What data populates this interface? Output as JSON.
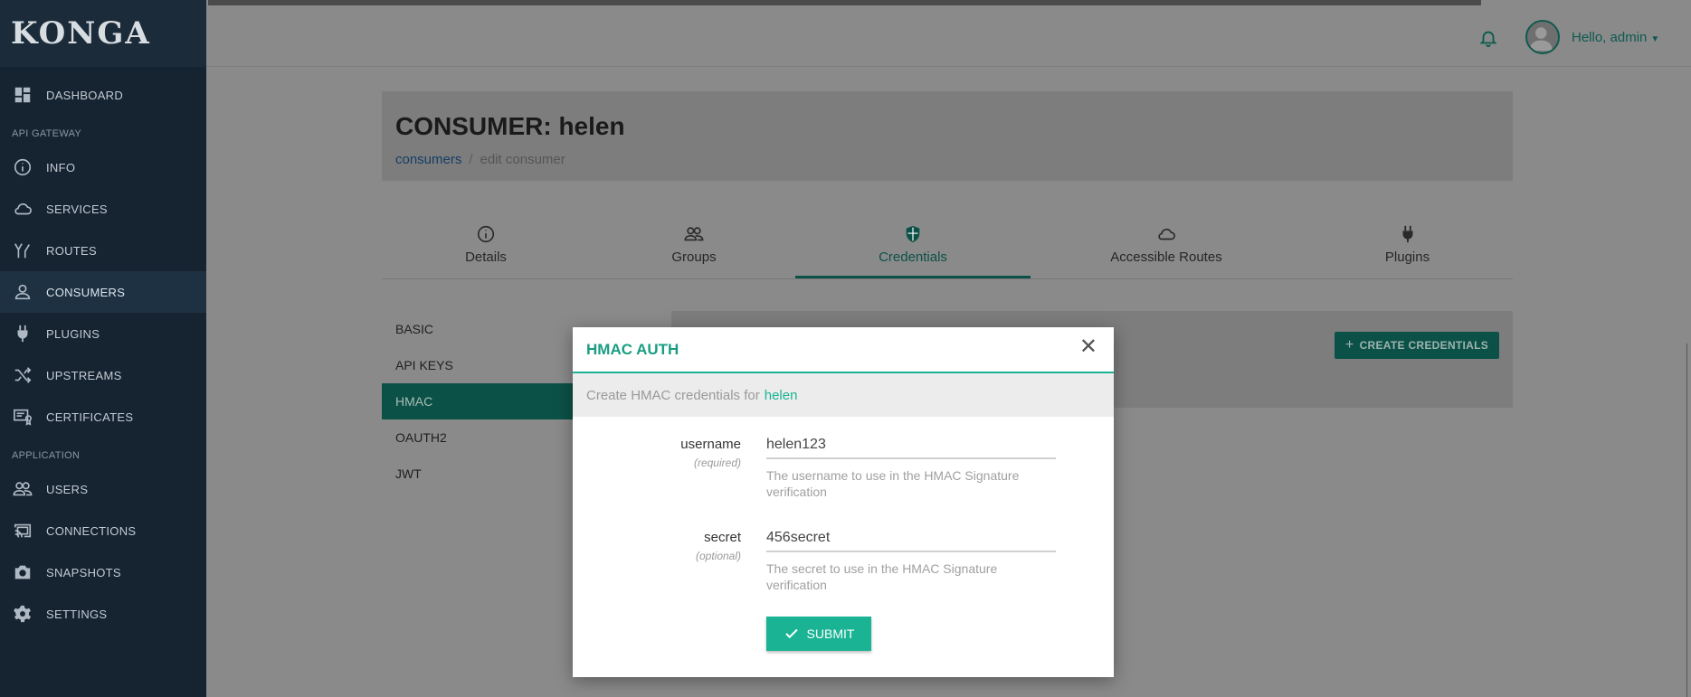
{
  "brand": "KONGA",
  "sidebar": {
    "items": [
      {
        "label": "DASHBOARD",
        "icon": "dashboard-icon"
      },
      {
        "label": "INFO",
        "icon": "info-icon"
      },
      {
        "label": "SERVICES",
        "icon": "cloud-icon"
      },
      {
        "label": "ROUTES",
        "icon": "routes-icon"
      },
      {
        "label": "CONSUMERS",
        "icon": "user-icon",
        "active": true
      },
      {
        "label": "PLUGINS",
        "icon": "plug-icon"
      },
      {
        "label": "UPSTREAMS",
        "icon": "shuffle-icon"
      },
      {
        "label": "CERTIFICATES",
        "icon": "certificate-icon"
      },
      {
        "label": "USERS",
        "icon": "users-icon"
      },
      {
        "label": "CONNECTIONS",
        "icon": "cast-icon"
      },
      {
        "label": "SNAPSHOTS",
        "icon": "camera-icon"
      },
      {
        "label": "SETTINGS",
        "icon": "gear-icon"
      }
    ],
    "sections": {
      "api_gateway": "API GATEWAY",
      "application": "APPLICATION"
    }
  },
  "topbar": {
    "greeting": "Hello, admin"
  },
  "header": {
    "title": "CONSUMER: helen",
    "breadcrumb": {
      "link": "consumers",
      "current": "edit consumer"
    }
  },
  "tabs": [
    {
      "label": "Details",
      "icon": "info-icon"
    },
    {
      "label": "Groups",
      "icon": "users-icon"
    },
    {
      "label": "Credentials",
      "icon": "shield-icon",
      "active": true
    },
    {
      "label": "Accessible Routes",
      "icon": "cloud-icon"
    },
    {
      "label": "Plugins",
      "icon": "plug-icon"
    }
  ],
  "credential_types": [
    "BASIC",
    "API KEYS",
    "HMAC",
    "OAUTH2",
    "JWT"
  ],
  "active_credential_type": "HMAC",
  "create_button": "CREATE CREDENTIALS",
  "modal": {
    "title": "HMAC AUTH",
    "info_prefix": "Create HMAC credentials for",
    "consumer": "helen",
    "fields": {
      "username": {
        "label": "username",
        "requirement": "(required)",
        "value": "helen123",
        "help": "The username to use in the HMAC Signature verification"
      },
      "secret": {
        "label": "secret",
        "requirement": "(optional)",
        "value": "456secret",
        "help": "The secret to use in the HMAC Signature verification"
      }
    },
    "submit_label": "SUBMIT"
  },
  "colors": {
    "accent": "#1ab394",
    "sidebar_bg": "#162330",
    "overlay_bg": "#8a8a8a",
    "active_dark": "#0c5147"
  }
}
